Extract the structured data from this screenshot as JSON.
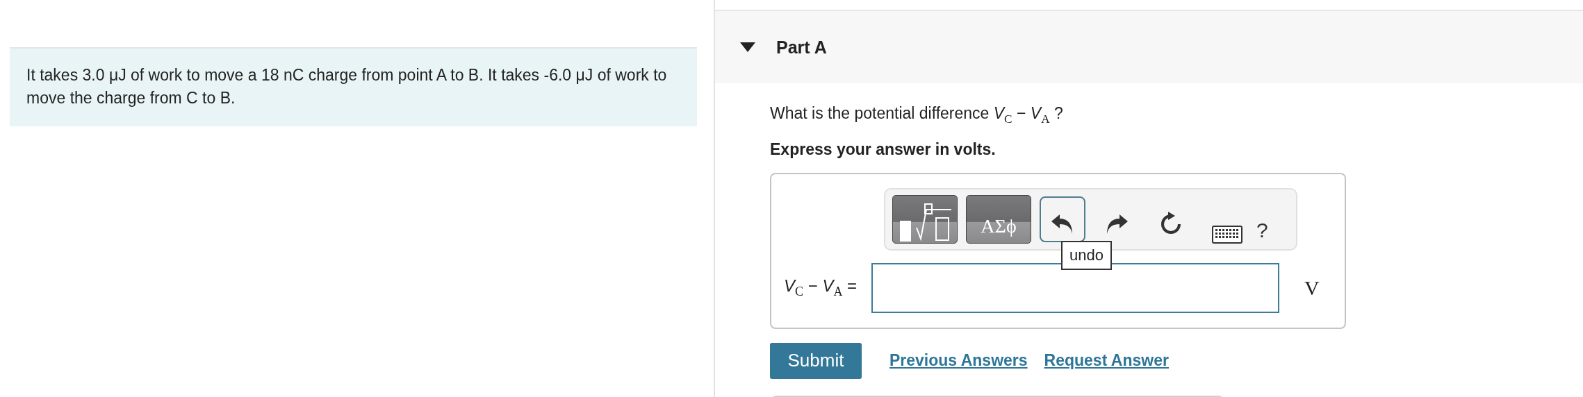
{
  "problem": {
    "text": "It takes 3.0 μJ of work to move a 18 nC charge from point A to B. It takes -6.0 μJ of work to move the charge from C to B."
  },
  "part": {
    "title": "Part A",
    "expanded": true,
    "question": "What is the potential difference *V*$_{C}$ − *V*$_{A}$ ?",
    "instruction": "Express your answer in volts.",
    "toolbar": [
      {
        "kind": "templates"
      },
      {
        "kind": "symbols",
        "label": "ΑΣϕ"
      },
      {
        "kind": "undo",
        "focused": true
      },
      {
        "kind": "redo",
        "focused": false
      },
      {
        "kind": "reset",
        "focused": false
      },
      {
        "kind": "keyboard"
      },
      {
        "kind": "help",
        "label": "?"
      }
    ],
    "tooltip": "undo",
    "equation_label": "*V*$_{C}$ − *V*$_{A}$ =",
    "unit": "V",
    "submit": "Submit",
    "links": [
      "Previous Answers",
      "Request Answer"
    ]
  }
}
